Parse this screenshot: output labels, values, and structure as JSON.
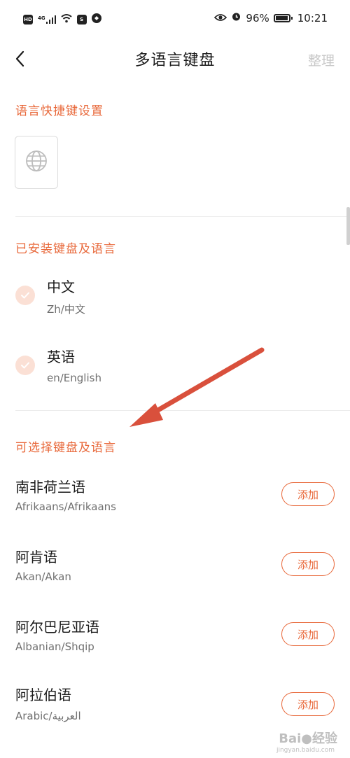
{
  "status_bar": {
    "left_badges": [
      "HD",
      "S"
    ],
    "network": "4G",
    "battery_percent_text": "96%",
    "battery_level": 0.96,
    "time": "10:21"
  },
  "header": {
    "title": "多语言键盘",
    "right_action": "整理",
    "back_icon": "chevron-left-icon"
  },
  "shortcut_section": {
    "title": "语言快捷键设置",
    "icon": "globe-icon"
  },
  "installed_section": {
    "title": "已安装键盘及语言",
    "items": [
      {
        "name": "中文",
        "sub": "Zh/中文"
      },
      {
        "name": "英语",
        "sub": "en/English"
      }
    ]
  },
  "available_section": {
    "title": "可选择键盘及语言",
    "add_label": "添加",
    "items": [
      {
        "name": "南非荷兰语",
        "sub": "Afrikaans/Afrikaans"
      },
      {
        "name": "阿肯语",
        "sub": "Akan/Akan"
      },
      {
        "name": "阿尔巴尼亚语",
        "sub": "Albanian/Shqip"
      },
      {
        "name": "阿拉伯语",
        "sub": "Arabic/العربية"
      }
    ]
  },
  "colors": {
    "accent": "#e8683a",
    "annotation_arrow": "#d9503c"
  },
  "watermark": {
    "brand": "Bai",
    "suffix": "经验",
    "url": "jingyan.baidu.com"
  }
}
